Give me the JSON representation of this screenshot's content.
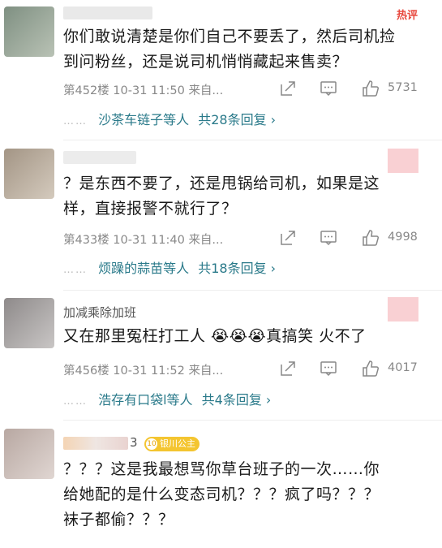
{
  "comments": [
    {
      "name": "",
      "hot_label": "热评",
      "text_line1": "你们敢说清楚是你们自己不要丢了，然后司机捡",
      "text_line2": "到问粉丝，还是说司机悄悄藏起来售卖？",
      "meta": {
        "floor": "第452楼",
        "time": "10-31 11:50",
        "source": "来自...",
        "likes": "5731"
      },
      "replies": {
        "dots": "……",
        "users": "沙茶车链子等人",
        "total": "共28条回复 ›"
      },
      "avatar_color": "#93a096"
    },
    {
      "name": "",
      "text_line1": "？是东西不要了，还是甩锅给司机，如果是这",
      "text_line2": "样，直接报警不就行了？",
      "meta": {
        "floor": "第433楼",
        "time": "10-31 11:40",
        "source": "来自...",
        "likes": "4998"
      },
      "replies": {
        "dots": "……",
        "users": "烦躁的蒜苗等人",
        "total": "共18条回复 ›"
      },
      "avatar_color": "#b3a79a"
    },
    {
      "name": "加减乘除加班",
      "text_line1": "又在那里冤枉打工人 😭😭😭真搞笑  火不了",
      "meta": {
        "floor": "第456楼",
        "time": "10-31 11:52",
        "source": "来自...",
        "likes": "4017"
      },
      "replies": {
        "dots": "……",
        "users": "浩存有口袋l等人",
        "total": "共4条回复 ›"
      },
      "avatar_color": "#a39f9e"
    },
    {
      "name": "3",
      "badge_level": "10",
      "badge_text": "银川公主",
      "text_line1": "？？？这是我最想骂你草台班子的一次……你",
      "text_line2": "给她配的是什么变态司机？？？疯了吗？？？",
      "text_line3": "袜子都偷？？？",
      "avatar_color": "#c2b3ad"
    }
  ],
  "icons": {
    "share": "share-icon",
    "comment": "comment-icon",
    "like": "thumbs-up-icon",
    "chevron": "chevron-right-icon"
  },
  "colors": {
    "link": "#2a7a8a",
    "hot": "#e8493f",
    "meta": "#888888"
  }
}
